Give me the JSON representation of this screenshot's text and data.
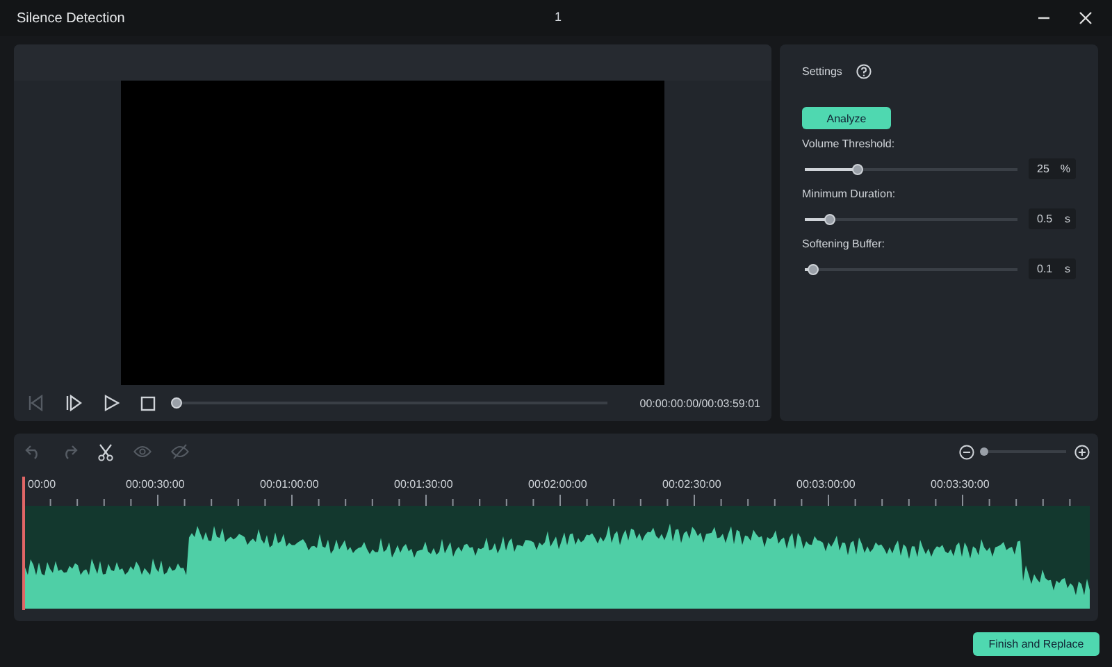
{
  "window": {
    "title": "Silence Detection",
    "center_label": "1"
  },
  "player": {
    "progress": {
      "level": 0
    },
    "timecode": "00:00:00:00/00:03:59:01"
  },
  "settings": {
    "title": "Settings",
    "analyze_button": "Analyze",
    "sliders": [
      {
        "label": "Volume Threshold:",
        "level": 0.25,
        "value": "25",
        "unit": "%"
      },
      {
        "label": "Minimum Duration:",
        "level": 0.12,
        "value": "0.5",
        "unit": "s"
      },
      {
        "label": "Softening Buffer:",
        "level": 0.04,
        "value": "0.1",
        "unit": "s"
      }
    ]
  },
  "timeline": {
    "tools": [
      {
        "kind": "undo",
        "disabled": true
      },
      {
        "kind": "redo",
        "disabled": true
      },
      {
        "kind": "cut",
        "disabled": false
      },
      {
        "kind": "eye",
        "disabled": true
      },
      {
        "kind": "eye-off",
        "disabled": true
      }
    ],
    "zoom": {
      "level": 0.02
    },
    "ruler": [
      "00:00",
      "00:00:30:00",
      "00:01:00:00",
      "00:01:30:00",
      "00:02:00:00",
      "00:02:30:00",
      "00:03:00:00",
      "00:03:30:00"
    ]
  },
  "footer": {
    "button": "Finish and Replace"
  }
}
